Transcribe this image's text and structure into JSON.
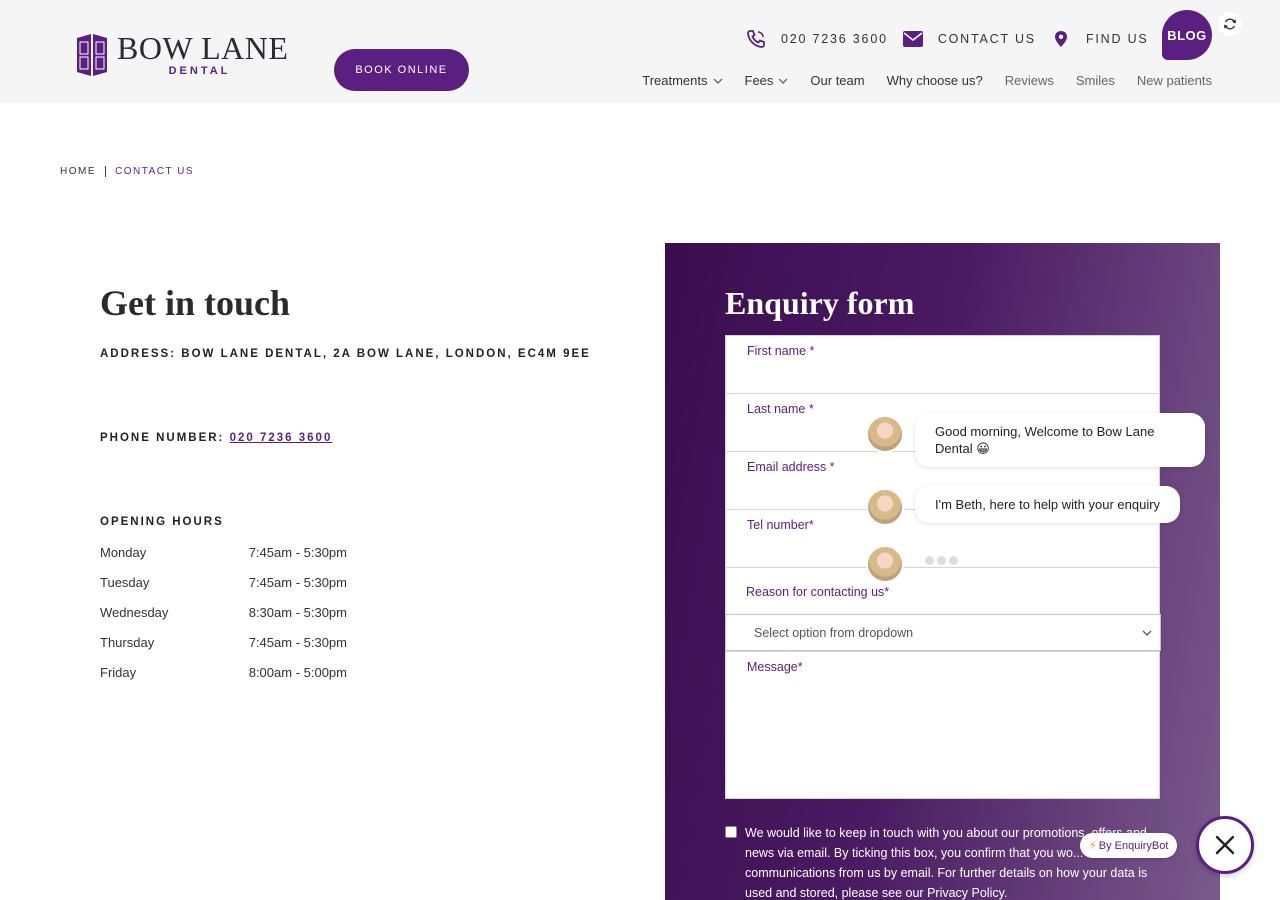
{
  "header": {
    "logo": {
      "main": "BOW LANE",
      "sub": "DENTAL"
    },
    "book_label": "BOOK ONLINE",
    "phone": "020 7236 3600",
    "contact_label": "CONTACT US",
    "find_label": "FIND US",
    "blog_label": "BLOG"
  },
  "nav": {
    "items": [
      {
        "label": "Treatments",
        "dropdown": true
      },
      {
        "label": "Fees",
        "dropdown": true
      },
      {
        "label": "Our team"
      },
      {
        "label": "Why choose us?"
      },
      {
        "label": "Reviews"
      },
      {
        "label": "Smiles"
      },
      {
        "label": "New patients"
      }
    ]
  },
  "breadcrumb": {
    "home": "HOME",
    "current": "CONTACT US"
  },
  "contact": {
    "title": "Get in touch",
    "address_label": "ADDRESS:",
    "address": "BOW LANE DENTAL, 2A BOW LANE, LONDON, EC4M 9EE",
    "phone_label": "PHONE NUMBER:",
    "phone": "020 7236 3600",
    "hours_title": "OPENING HOURS",
    "hours": [
      {
        "day": "Monday",
        "time": "7:45am - 5:30pm"
      },
      {
        "day": "Tuesday",
        "time": "7:45am - 5:30pm"
      },
      {
        "day": "Wednesday",
        "time": "8:30am - 5:30pm"
      },
      {
        "day": "Thursday",
        "time": "7:45am - 5:30pm"
      },
      {
        "day": "Friday",
        "time": "8:00am - 5:00pm"
      }
    ]
  },
  "form": {
    "title": "Enquiry form",
    "first_name": "First name *",
    "last_name": "Last name *",
    "email": "Email address *",
    "tel": "Tel number*",
    "reason_label": "Reason for contacting us*",
    "reason_value": "Select option from dropdown",
    "message": "Message*",
    "consent": "We would like to keep in touch with you about our promotions, offers and news via email. By ticking this box, you confirm that you wo... receive communications from us by email. For further details on how your data is used and stored, please see our Privacy Policy."
  },
  "chat": {
    "msg1": "Good morning, Welcome to Bow Lane Dental 😀",
    "msg2": "I'm Beth, here to help with your enquiry",
    "badge": "By EnquiryBot"
  },
  "colors": {
    "brand": "#5a1f80",
    "panel": "#3a0d50"
  }
}
